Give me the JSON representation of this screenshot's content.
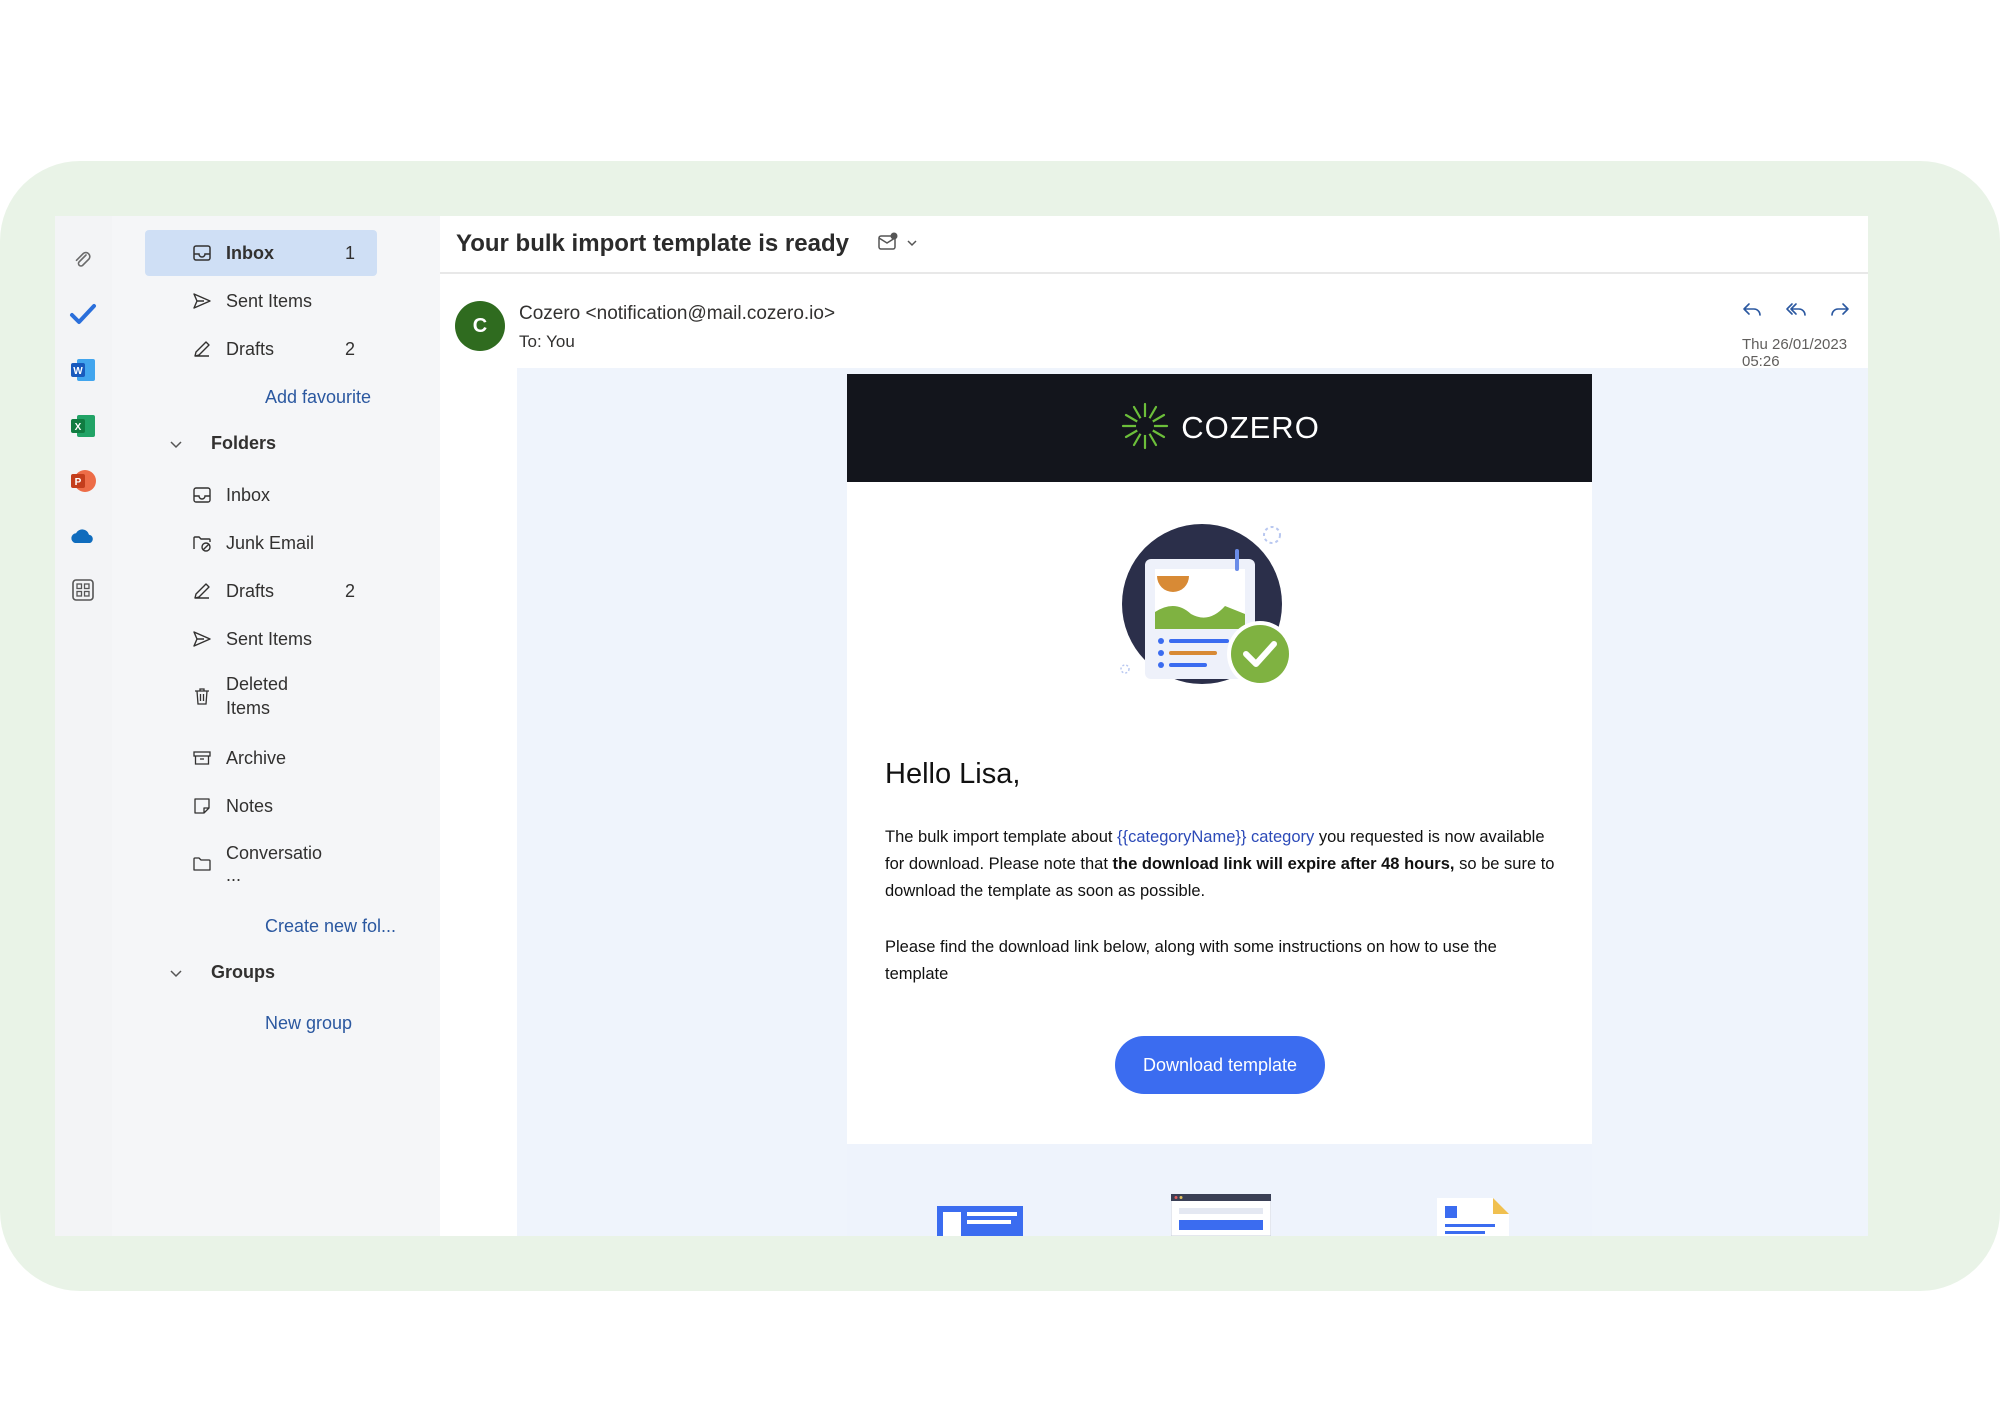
{
  "favourites": [
    {
      "label": "Inbox",
      "count": "1",
      "icon": "inbox-icon",
      "selected": true
    },
    {
      "label": "Sent Items",
      "count": "",
      "icon": "send-icon"
    },
    {
      "label": "Drafts",
      "count": "2",
      "icon": "pencil-icon"
    }
  ],
  "add_favourite": "Add favourite",
  "folders_header": "Folders",
  "folders": [
    {
      "label": "Inbox",
      "count": "",
      "icon": "inbox-icon"
    },
    {
      "label": "Junk Email",
      "count": "",
      "icon": "junk-icon"
    },
    {
      "label": "Drafts",
      "count": "2",
      "icon": "pencil-icon"
    },
    {
      "label": "Sent Items",
      "count": "",
      "icon": "send-icon"
    },
    {
      "label_line1": "Deleted",
      "label_line2": "Items",
      "count": "",
      "icon": "trash-icon"
    },
    {
      "label": "Archive",
      "count": "",
      "icon": "archive-icon"
    },
    {
      "label": "Notes",
      "count": "",
      "icon": "note-icon"
    },
    {
      "label_line1": "Conversatio",
      "label_line2": "...",
      "count": "",
      "icon": "folder-icon"
    }
  ],
  "create_folder": "Create new fol...",
  "groups_header": "Groups",
  "new_group": "New group",
  "message": {
    "subject": "Your bulk import template is ready",
    "avatar_initial": "C",
    "sender": "Cozero <notification@mail.cozero.io>",
    "to_label": "To:",
    "to_value": "You",
    "date": "Thu 26/01/2023 05:26"
  },
  "email": {
    "brand": "COZERO",
    "greeting": "Hello  Lisa,",
    "p1_a": "The bulk import template about ",
    "p1_var": "{{categoryName}} category",
    "p1_b": " you requested is now available for download. Please note that ",
    "p1_bold": "the download link will expire after 48 hours,",
    "p1_c": " so be sure to download the template as soon as possible.",
    "p2": "Please find the download link below, along with some instructions on how to use the template",
    "button": "Download template"
  },
  "colors": {
    "accent_blue": "#3b6cf0",
    "selected_bg": "#cfdff5",
    "link": "#2b58a0",
    "brand_band": "#13151c",
    "success_green": "#7fb241",
    "frame_green": "#e9f3e7"
  }
}
